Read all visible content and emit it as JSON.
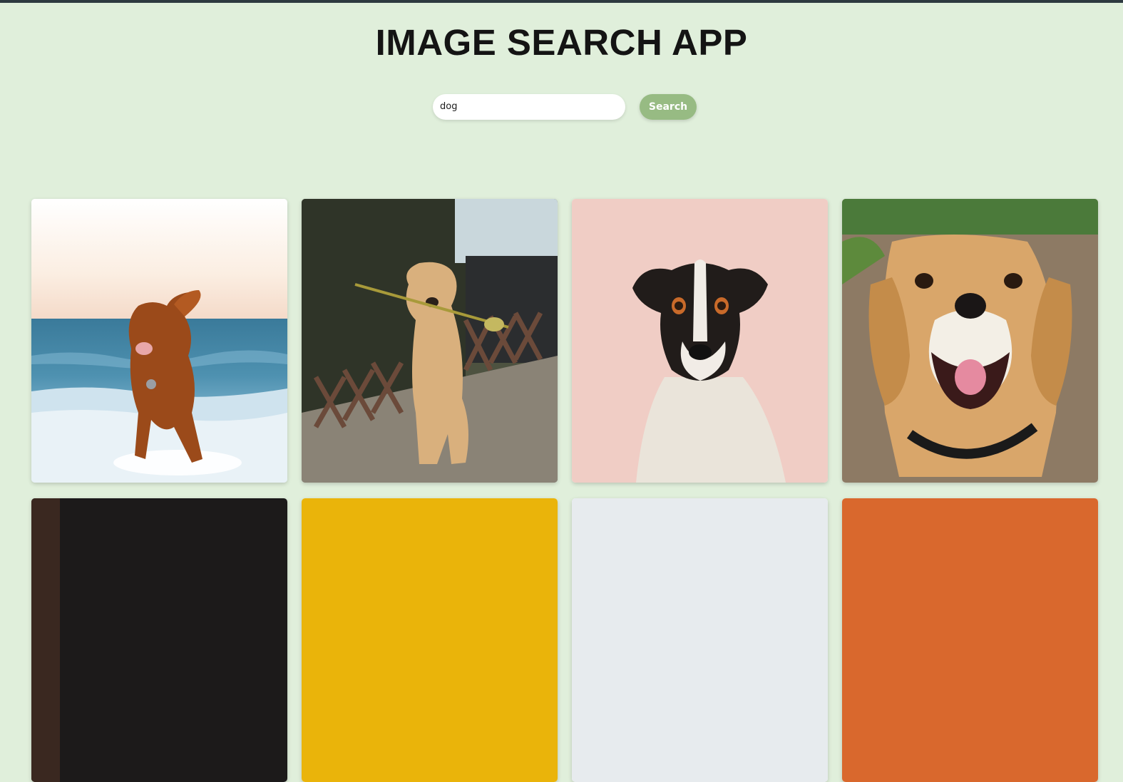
{
  "header": {
    "title": "IMAGE SEARCH APP"
  },
  "search": {
    "value": "dog",
    "button_label": "Search"
  },
  "results": [
    {
      "subject": "dog-running-in-surf-image",
      "background_color": "#7eb0c8"
    },
    {
      "subject": "golden-retriever-with-flower-image",
      "background_color": "#6b6a62"
    },
    {
      "subject": "terrier-on-pink-background-image",
      "background_color": "#f0cdc5"
    },
    {
      "subject": "smiling-beagle-image",
      "background_color": "#8d7a64"
    },
    {
      "subject": "dark-photo-image",
      "background_color": "#1c1a1a"
    },
    {
      "subject": "yellow-photo-image",
      "background_color": "#eab40a"
    },
    {
      "subject": "light-gray-photo-image",
      "background_color": "#e7ebee"
    },
    {
      "subject": "orange-photo-image",
      "background_color": "#d9682d"
    }
  ],
  "colors": {
    "page_background": "#e0efdb",
    "accent": "#97bb83",
    "title": "#141414"
  }
}
